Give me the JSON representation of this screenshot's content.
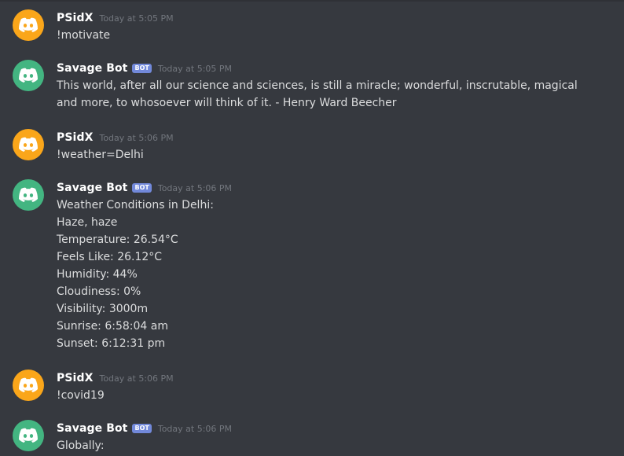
{
  "colors": {
    "background": "#36393f",
    "user_avatar": "#faa61a",
    "bot_avatar": "#43b581",
    "bot_tag": "#7289da",
    "username": "#ffffff",
    "timestamp": "#72767d",
    "text": "#dcddde"
  },
  "messages": [
    {
      "author": "PSidX",
      "is_bot": false,
      "timestamp": "Today at 5:05 PM",
      "lines": [
        "!motivate"
      ]
    },
    {
      "author": "Savage Bot",
      "is_bot": true,
      "bot_tag": "BOT",
      "timestamp": "Today at 5:05 PM",
      "lines": [
        "This world, after all our science and sciences, is still a miracle; wonderful, inscrutable, magical and more, to whosoever will think of it. - Henry Ward Beecher"
      ]
    },
    {
      "author": "PSidX",
      "is_bot": false,
      "timestamp": "Today at 5:06 PM",
      "lines": [
        "!weather=Delhi"
      ]
    },
    {
      "author": "Savage Bot",
      "is_bot": true,
      "bot_tag": "BOT",
      "timestamp": "Today at 5:06 PM",
      "lines": [
        "Weather Conditions in Delhi:",
        "Haze, haze",
        "Temperature: 26.54°C",
        "Feels Like: 26.12°C",
        "Humidity: 44%",
        "Cloudiness: 0%",
        "Visibility: 3000m",
        "Sunrise: 6:58:04 am",
        "Sunset: 6:12:31 pm"
      ]
    },
    {
      "author": "PSidX",
      "is_bot": false,
      "timestamp": "Today at 5:06 PM",
      "lines": [
        "!covid19"
      ]
    },
    {
      "author": "Savage Bot",
      "is_bot": true,
      "bot_tag": "BOT",
      "timestamp": "Today at 5:06 PM",
      "lines": [
        "Globally:"
      ]
    }
  ],
  "icons": {
    "avatar": "discord-logo-icon"
  }
}
